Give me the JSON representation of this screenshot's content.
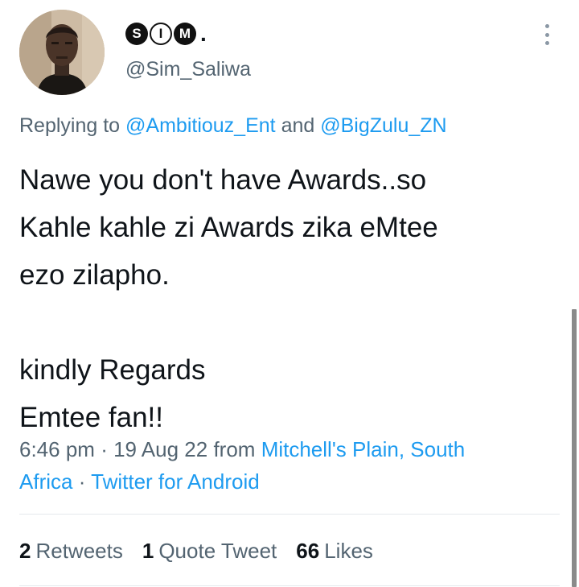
{
  "author": {
    "name_badges": [
      "S",
      "I",
      "M"
    ],
    "name_suffix": ".",
    "handle": "@Sim_Saliwa"
  },
  "reply": {
    "prefix": "Replying to",
    "user1": "@Ambitiouz_Ent",
    "joiner": "and",
    "user2": "@BigZulu_ZN"
  },
  "body": {
    "lines": [
      "Nawe you don't have Awards..so",
      "Kahle kahle zi Awards zika eMtee",
      "ezo zilapho."
    ],
    "lines2": [
      "kindly Regards",
      "Emtee fan!!"
    ]
  },
  "meta": {
    "time": "6:46 pm",
    "sep": "·",
    "date": "19 Aug 22",
    "from": "from",
    "location_line1": "Mitchell's Plain, South",
    "location_line2": "Africa",
    "client": "Twitter for Android"
  },
  "stats": {
    "retweets_count": "2",
    "retweets_label": "Retweets",
    "quotes_count": "1",
    "quotes_label": "Quote Tweet",
    "likes_count": "66",
    "likes_label": "Likes"
  },
  "colors": {
    "link": "#1d9bf0",
    "secondary": "#536471",
    "text": "#0f1419"
  }
}
